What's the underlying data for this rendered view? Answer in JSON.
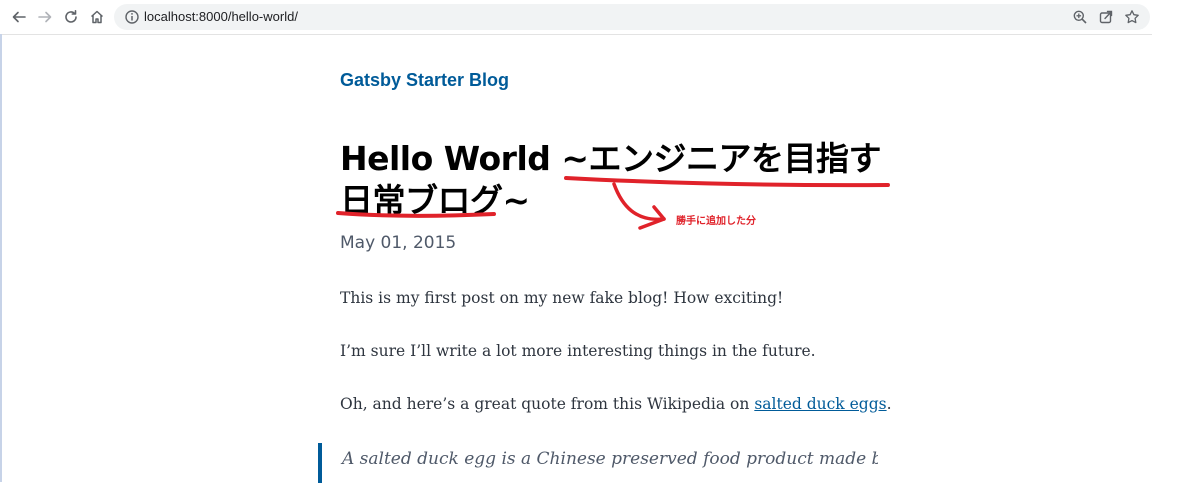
{
  "browser": {
    "url": "localhost:8000/hello-world/",
    "icons": {
      "back": "arrow-left-icon",
      "forward": "arrow-right-icon",
      "reload": "reload-icon",
      "home": "home-icon",
      "info": "info-icon",
      "zoom": "zoom-icon",
      "share": "share-icon",
      "bookmark": "star-icon"
    }
  },
  "site": {
    "title": "Gatsby Starter Blog",
    "brand_color": "#005b99"
  },
  "post": {
    "title": "Hello World ~エンジニアを目指す日常ブログ~",
    "date": "May 01, 2015",
    "paragraphs": {
      "p1": "This is my first post on my new fake blog! How exciting!",
      "p2": "I’m sure I’ll write a lot more interesting things in the future.",
      "p3_prefix": "Oh, and here’s a great quote from this Wikipedia on ",
      "p3_link": "salted duck eggs",
      "p3_suffix": "."
    },
    "blockquote": "A salted duck egg is a Chinese preserved food product made by"
  },
  "annotation": {
    "label": "勝手に追加した分",
    "color": "#e0222a"
  }
}
